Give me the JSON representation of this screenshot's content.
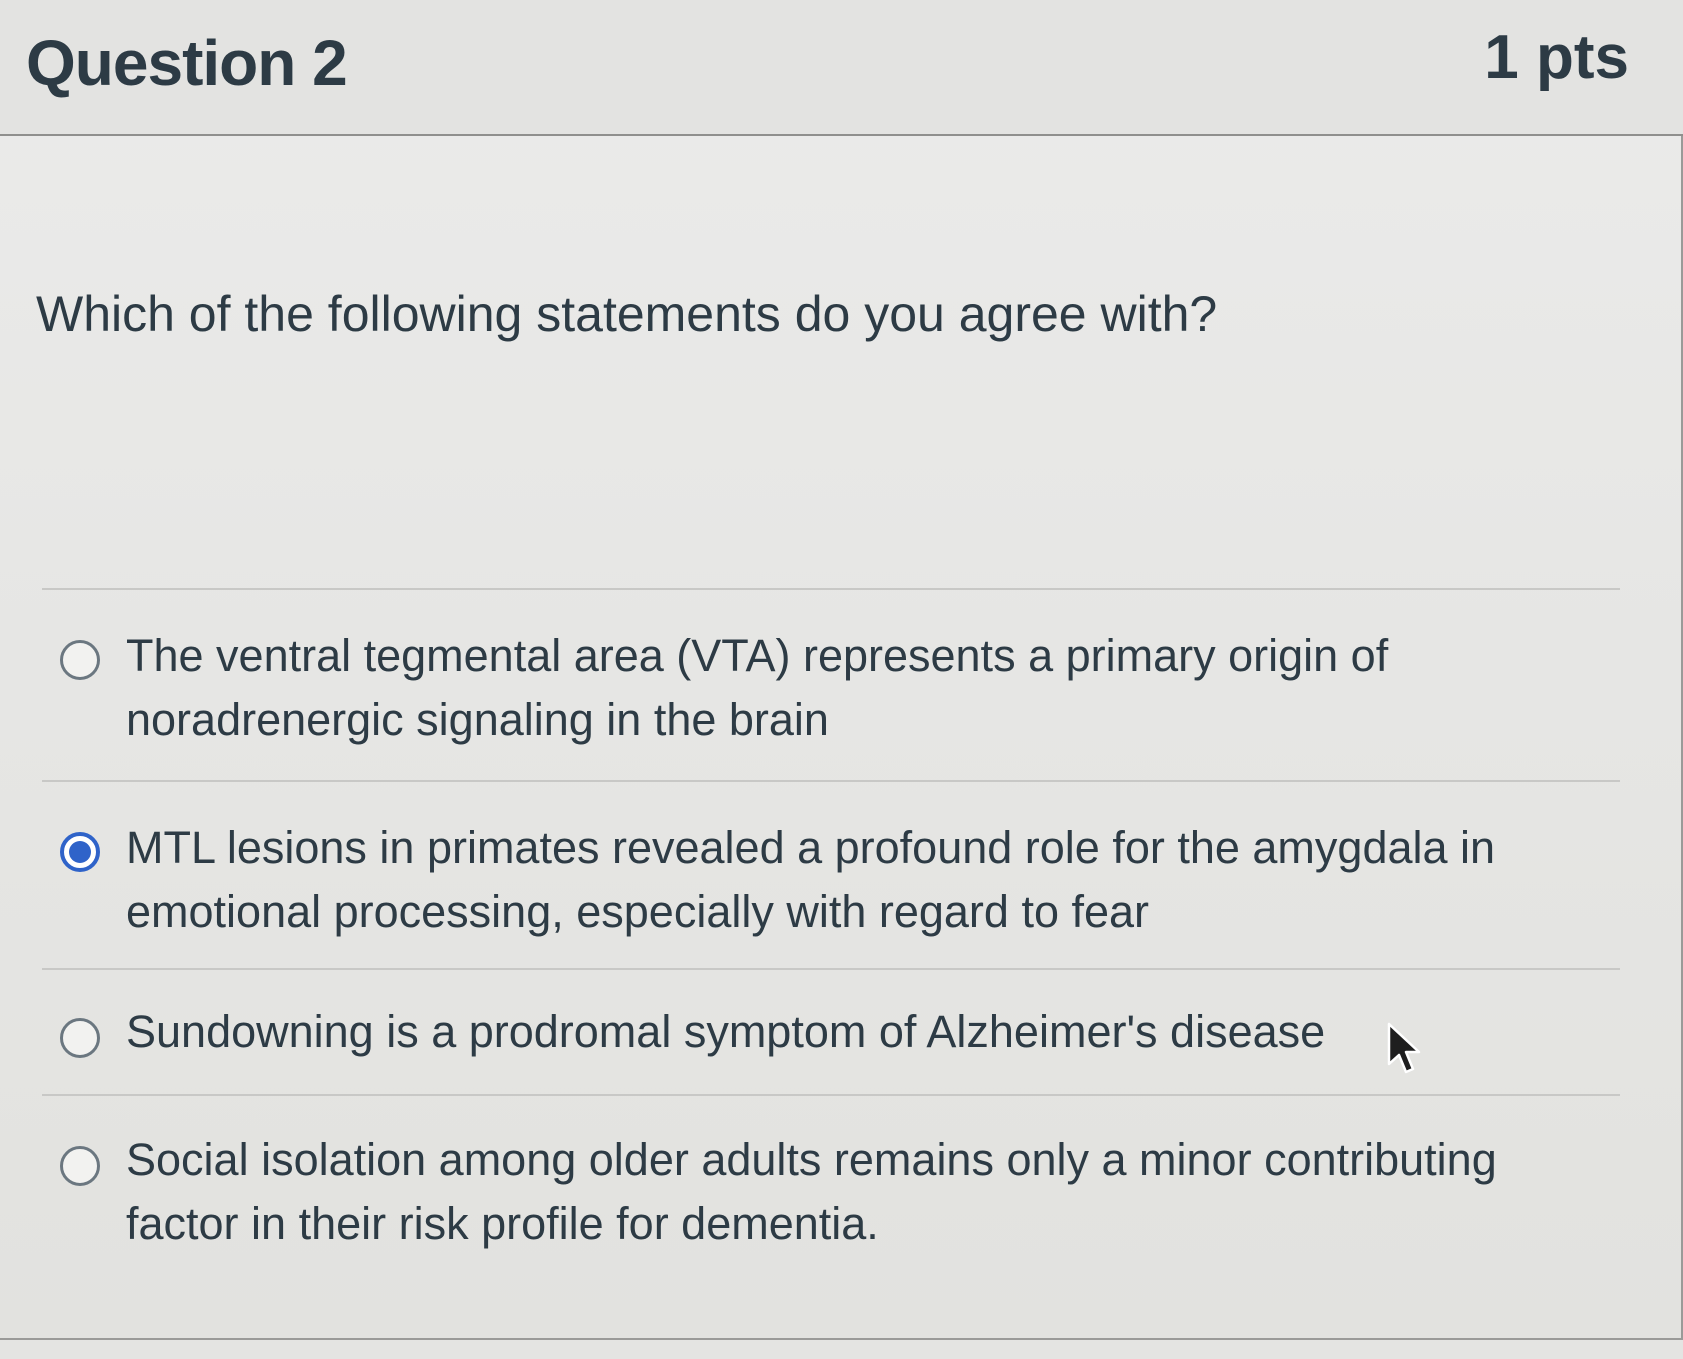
{
  "header": {
    "title": "Question 2",
    "points": "1 pts"
  },
  "question": {
    "text": "Which of the following statements do you agree with?"
  },
  "answers": [
    {
      "label": "The ventral tegmental area (VTA) represents a primary origin of noradrenergic signaling in the brain",
      "selected": false
    },
    {
      "label": "MTL lesions in primates revealed a profound role for the amygdala in emotional processing, especially with regard to fear",
      "selected": true
    },
    {
      "label": "Sundowning is a prodromal symptom of Alzheimer's disease",
      "selected": false
    },
    {
      "label": "Social isolation among older adults remains only a minor contributing factor in their risk profile for dementia.",
      "selected": false
    }
  ],
  "colors": {
    "text": "#2d3b45",
    "radio_selected": "#2f63c9",
    "background": "#e6e6e4"
  },
  "icons": {
    "cursor": "mouse-pointer-icon"
  }
}
